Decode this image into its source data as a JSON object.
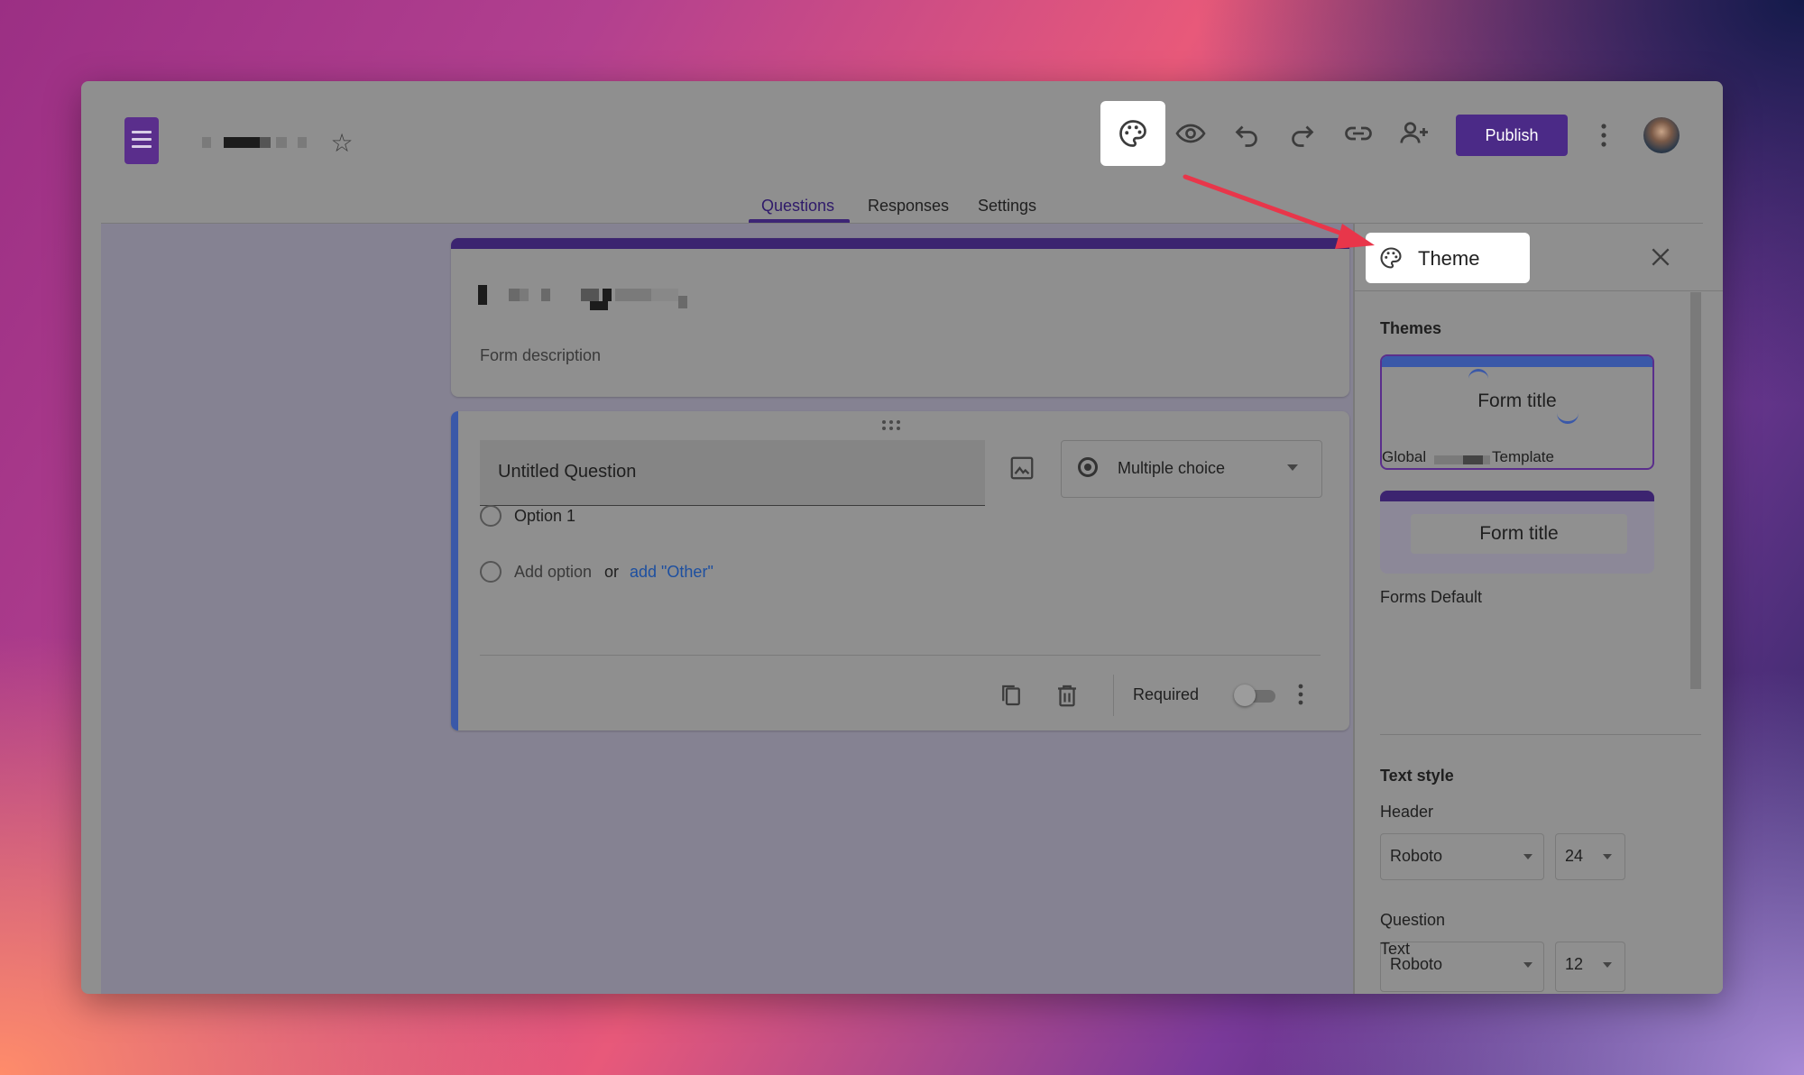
{
  "topbar": {
    "form_icon": "forms-doc-icon",
    "star_icon": "star-icon",
    "toolbar_icons": [
      "palette-icon",
      "eye-icon",
      "undo-icon",
      "redo-icon",
      "link-icon",
      "add-person-icon"
    ],
    "publish_label": "Publish",
    "more_icon": "kebab-icon"
  },
  "tabs": [
    {
      "label": "Questions",
      "active": true
    },
    {
      "label": "Responses",
      "active": false
    },
    {
      "label": "Settings",
      "active": false
    }
  ],
  "form": {
    "description_placeholder": "Form description",
    "accent_color": "#3c2470"
  },
  "question": {
    "title": "Untitled Question",
    "type": "Multiple choice",
    "options": [
      "Option 1"
    ],
    "add_option": "Add option",
    "or": "or",
    "add_other": "add \"Other\"",
    "required_label": "Required",
    "required_on": false
  },
  "theme_panel": {
    "title": "Theme",
    "themes_heading": "Themes",
    "theme_cards": [
      {
        "preview_title": "Form title",
        "name_left": "Global",
        "name_right": "Template",
        "selected": true
      },
      {
        "preview_title": "Form title",
        "name": "Forms Default",
        "selected": false
      }
    ],
    "text_style_heading": "Text style",
    "header": {
      "label": "Header",
      "font": "Roboto",
      "size": "24"
    },
    "question": {
      "label": "Question",
      "font": "Roboto",
      "size": "12"
    },
    "text": {
      "label": "Text"
    }
  },
  "colors": {
    "publish_bg": "#4b2a87",
    "annotation_arrow": "#e8364a",
    "link_blue": "#1d4fa0"
  }
}
